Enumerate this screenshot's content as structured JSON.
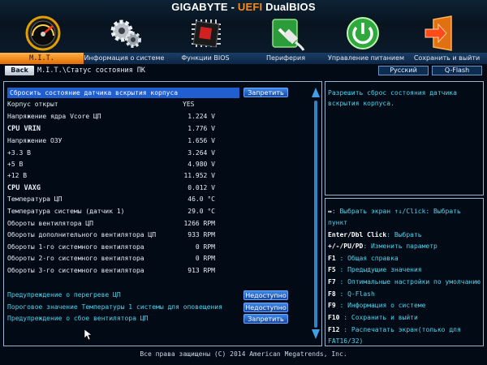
{
  "header": {
    "brand_prefix": "GIGABYTE - ",
    "brand_accent": "UEFI",
    "brand_suffix": " DualBIOS",
    "icons": [
      "speedometer-icon",
      "gears-icon",
      "chip-icon",
      "plug-icon",
      "power-icon",
      "exit-icon"
    ]
  },
  "menu": {
    "items": [
      {
        "label": "M.I.T.",
        "active": true
      },
      {
        "label": "Информация о системе",
        "active": false
      },
      {
        "label": "Функции BIOS",
        "active": false
      },
      {
        "label": "Периферия",
        "active": false
      },
      {
        "label": "Управление питанием",
        "active": false
      },
      {
        "label": "Сохранить и выйти",
        "active": false
      }
    ]
  },
  "subbar": {
    "back_label": "Back",
    "breadcrumb": "M.I.T.\\Статус состояния ПК",
    "language_label": "Русский",
    "qflash_label": "Q-Flash"
  },
  "main": {
    "selected_row": {
      "label": "Сбросить состояние датчика вскрытия корпуса",
      "button": "Запретить"
    },
    "rows": [
      {
        "label": "Корпус открыт",
        "value": "YES"
      },
      {
        "label": "Напряжение ядра Vcore ЦП",
        "value": "1.224 V"
      },
      {
        "label": "CPU VRIN",
        "value": "1.776 V"
      },
      {
        "label": "Напряжение ОЗУ",
        "value": "1.656 V"
      },
      {
        "label": "+3.3 В",
        "value": "3.264 V"
      },
      {
        "label": "+5 В",
        "value": "4.980 V"
      },
      {
        "label": "+12 В",
        "value": "11.952 V"
      },
      {
        "label": "CPU VAXG",
        "value": "0.012 V"
      },
      {
        "label": "Температура ЦП",
        "value": "46.0 °C"
      },
      {
        "label": "Температура системы (датчик 1)",
        "value": "29.0 °C"
      },
      {
        "label": "Обороты вентилятора ЦП",
        "value": "1266 RPM"
      },
      {
        "label": "Обороты дополнительного вентилятора ЦП",
        "value": "933 RPM"
      },
      {
        "label": "Обороты 1-го системного вентилятора",
        "value": "0 RPM"
      },
      {
        "label": "Обороты 2-го системного вентилятора",
        "value": "0 RPM"
      },
      {
        "label": "Обороты 3-го системного вентилятора",
        "value": "913 RPM"
      }
    ],
    "warnings": [
      {
        "label": "Предупреждение о перегреве ЦП",
        "button": "Недоступно"
      },
      {
        "label": "Пороговое значение Температуры 1 системы для оповещения",
        "button": "Недоступно"
      },
      {
        "label": "Предупреждение о сбое вентилятора ЦП",
        "button": "Запретить"
      }
    ]
  },
  "description": {
    "text": "Разрешить сброс состояния датчика вскрытия корпуса."
  },
  "help": {
    "lines": [
      {
        "key": "↔",
        "text": ": Выбрать экран  ↑↓/Click: Выбрать"
      },
      {
        "key": "",
        "text": "пункт"
      },
      {
        "key": "Enter/Dbl Click",
        "text": ": Выбрать"
      },
      {
        "key": "+/-/PU/PD",
        "text": ": Изменить параметр"
      },
      {
        "key": "F1",
        "text": "  : Общая справка"
      },
      {
        "key": "F5",
        "text": "  : Предыдущие значения"
      },
      {
        "key": "F7",
        "text": "  : Оптимальные настройки по умолчанию"
      },
      {
        "key": "F8",
        "text": "  : Q-Flash"
      },
      {
        "key": "F9",
        "text": "  : Информация о системе"
      },
      {
        "key": "F10",
        "text": " : Сохранить и выйти"
      },
      {
        "key": "F12",
        "text": " : Распечатать экран(только для"
      },
      {
        "key": "",
        "text": "FAT16/32)"
      }
    ]
  },
  "footer": {
    "copyright": "Все права защищены (C) 2014 American Megatrends, Inc."
  },
  "colors": {
    "accent_orange": "#ff8a1c",
    "selection_blue": "#1f5fd0",
    "help_cyan": "#4fd4ec",
    "background": "#020a16"
  }
}
